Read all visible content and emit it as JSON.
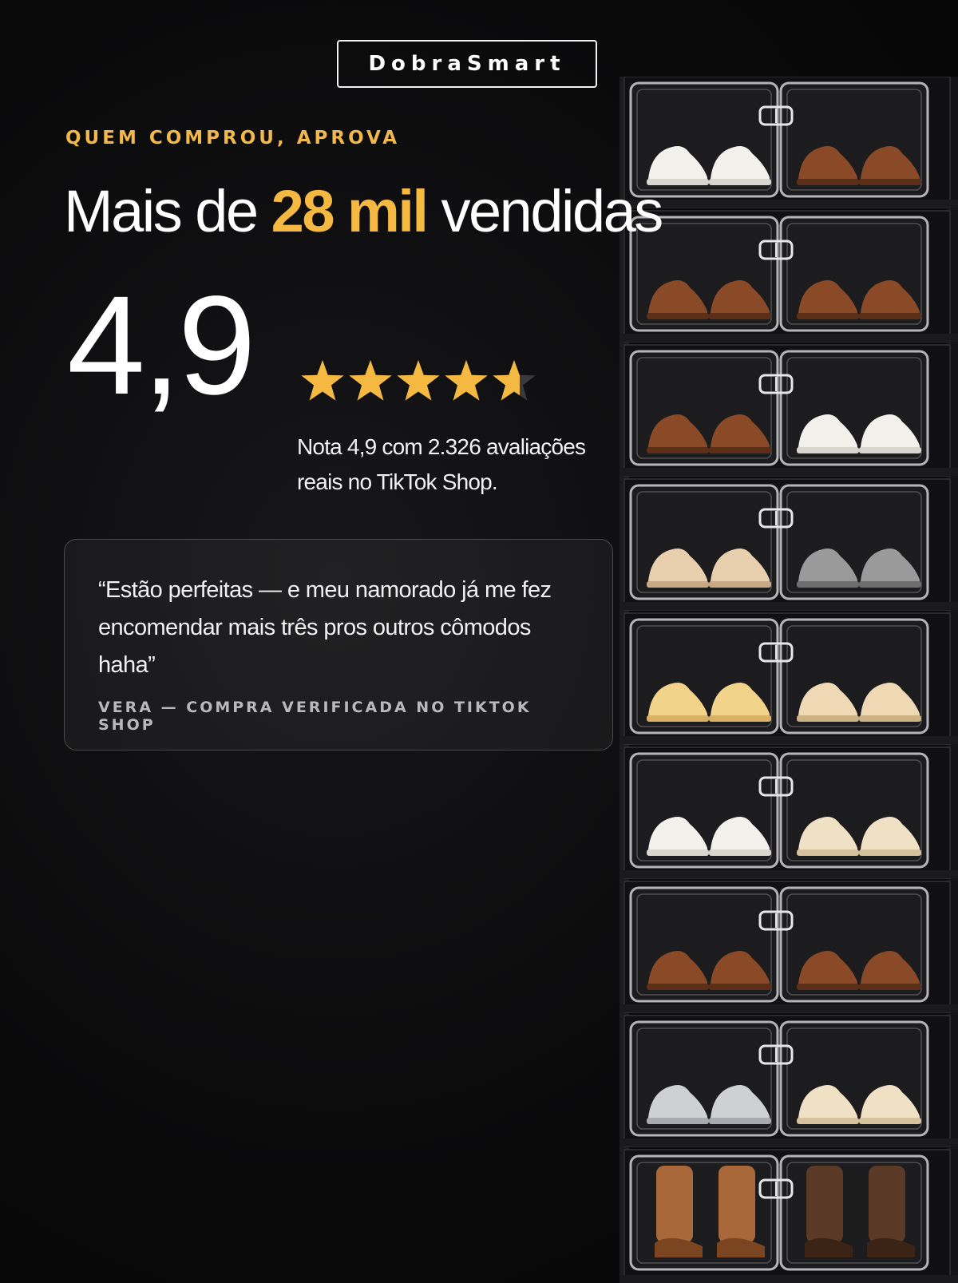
{
  "brand": {
    "name": "DobraSmart"
  },
  "eyebrow": "QUEM COMPROU, APROVA",
  "headline": {
    "prefix": "Mais de",
    "highlight": "28 mil",
    "suffix": "vendidas"
  },
  "rating": {
    "value_label": "4,9",
    "value": 4.9,
    "max": 5,
    "note_line1": "Nota 4,9 com 2.326 avaliações",
    "note_line2": "reais no TikTok Shop."
  },
  "testimonial": {
    "quote": "“Estão perfeitas — e meu namorado já me fez encomendar mais três pros outros cômodos haha”",
    "author": "VERA — COMPRA VERIFICADA NO TIKTOK SHOP"
  },
  "colors": {
    "accent": "#f5b942",
    "background": "#0b0b0c",
    "text": "#ffffff"
  },
  "icons": {
    "star": "star-icon"
  },
  "image": {
    "subject": "stackable transparent shoe box cabinet",
    "rows": [
      {
        "left": "white-sneakers",
        "right": "brown-loafers"
      },
      {
        "left": "brown-loafers",
        "right": "brown-loafers"
      },
      {
        "left": "brown-loafers",
        "right": "white-sneakers"
      },
      {
        "left": "beige-heels",
        "right": "grey-boots"
      },
      {
        "left": "yellow-sneakers",
        "right": "beige-sandals"
      },
      {
        "left": "white-sneakers",
        "right": "beige-sneakers"
      },
      {
        "left": "brown-loafers",
        "right": "brown-loafers"
      },
      {
        "left": "grey-sneakers",
        "right": "beige-sneakers"
      },
      {
        "left": "brown-tall-boots",
        "right": "dark-brown-tall-boots"
      }
    ]
  }
}
